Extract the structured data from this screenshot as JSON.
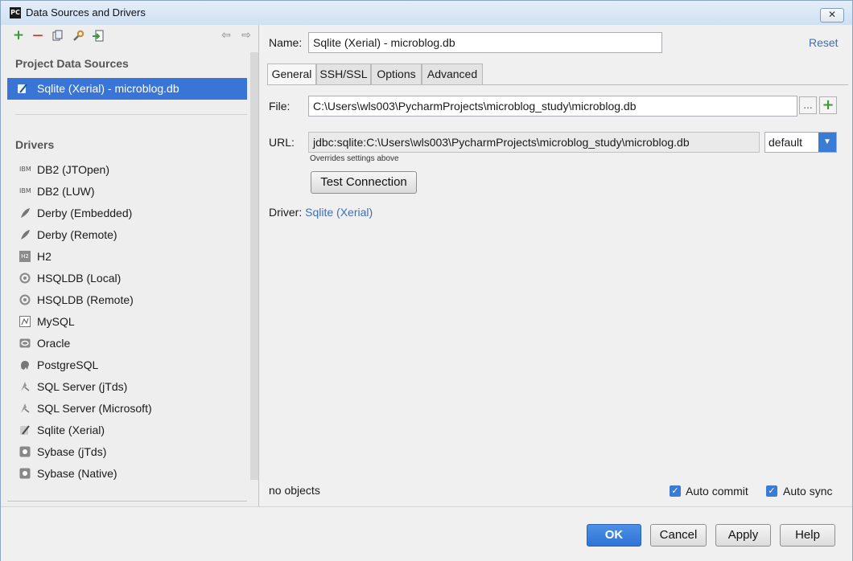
{
  "window": {
    "title": "Data Sources and Drivers",
    "app_icon": "PC",
    "close_glyph": "✕"
  },
  "toolbar": {
    "add_icon": "+",
    "remove_icon": "—",
    "copy_icon": "copy-icon",
    "settings_icon": "wrench-icon",
    "import_icon": "import-icon",
    "back_icon": "⇦",
    "forward_icon": "⇨"
  },
  "sidebar": {
    "project_header": "Project Data Sources",
    "project_items": [
      {
        "label": "Sqlite (Xerial) - microblog.db",
        "icon": "sqlite-icon",
        "selected": true
      }
    ],
    "drivers_header": "Drivers",
    "drivers": [
      {
        "label": "DB2 (JTOpen)",
        "icon": "IBM"
      },
      {
        "label": "DB2 (LUW)",
        "icon": "IBM"
      },
      {
        "label": "Derby (Embedded)",
        "icon": "feather"
      },
      {
        "label": "Derby (Remote)",
        "icon": "feather"
      },
      {
        "label": "H2",
        "icon": "H2"
      },
      {
        "label": "HSQLDB (Local)",
        "icon": "hsqldb"
      },
      {
        "label": "HSQLDB (Remote)",
        "icon": "hsqldb"
      },
      {
        "label": "MySQL",
        "icon": "mysql"
      },
      {
        "label": "Oracle",
        "icon": "oracle"
      },
      {
        "label": "PostgreSQL",
        "icon": "elephant"
      },
      {
        "label": "SQL Server (jTds)",
        "icon": "sqlserver"
      },
      {
        "label": "SQL Server (Microsoft)",
        "icon": "sqlserver"
      },
      {
        "label": "Sqlite (Xerial)",
        "icon": "sqlite"
      },
      {
        "label": "Sybase (jTds)",
        "icon": "sybase"
      },
      {
        "label": "Sybase (Native)",
        "icon": "sybase"
      }
    ]
  },
  "form": {
    "name_label": "Name:",
    "name_value": "Sqlite (Xerial) - microblog.db",
    "reset_label": "Reset",
    "tabs": [
      "General",
      "SSH/SSL",
      "Options",
      "Advanced"
    ],
    "active_tab": "General",
    "file_label": "File:",
    "file_value": "C:\\Users\\wls003\\PycharmProjects\\microblog_study\\microblog.db",
    "browse_label": "...",
    "add_label": "+",
    "url_label": "URL:",
    "url_value": "jdbc:sqlite:C:\\Users\\wls003\\PycharmProjects\\microblog_study\\microblog.db",
    "url_mode": "default",
    "url_hint": "Overrides settings above",
    "test_button": "Test Connection",
    "driver_label": "Driver:",
    "driver_link": "Sqlite (Xerial)",
    "status": "no objects",
    "auto_commit_label": "Auto commit",
    "auto_commit": true,
    "auto_sync_label": "Auto sync",
    "auto_sync": true
  },
  "footer": {
    "ok": "OK",
    "cancel": "Cancel",
    "apply": "Apply",
    "help": "Help"
  },
  "colors": {
    "accent": "#3875d7",
    "link": "#3b6fb6",
    "add_green": "#3a9a3a",
    "remove_red": "#c8392b"
  }
}
